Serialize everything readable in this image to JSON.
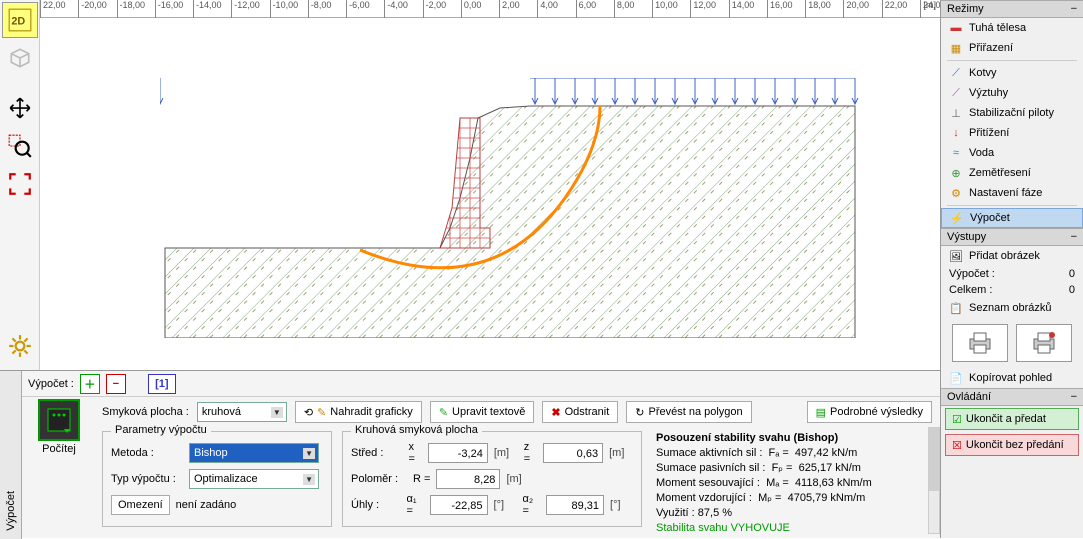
{
  "ruler": {
    "ticks": [
      "22,00",
      "-20,00",
      "-18,00",
      "-16,00",
      "-14,00",
      "-12,00",
      "-10,00",
      "-8,00",
      "-6,00",
      "-4,00",
      "-2,00",
      "0,00",
      "2,00",
      "4,00",
      "6,00",
      "8,00",
      "10,00",
      "12,00",
      "14,00",
      "16,00",
      "18,00",
      "20,00",
      "22,00",
      "24,00"
    ],
    "unit": "[m]"
  },
  "right": {
    "modes_title": "Režimy",
    "modes": [
      {
        "label": "Tuhá tělesa"
      },
      {
        "label": "Přiřazení"
      },
      {
        "label": "Kotvy"
      },
      {
        "label": "Výztuhy"
      },
      {
        "label": "Stabilizační piloty"
      },
      {
        "label": "Přitížení"
      },
      {
        "label": "Voda"
      },
      {
        "label": "Zemětřesení"
      },
      {
        "label": "Nastavení fáze"
      },
      {
        "label": "Výpočet"
      }
    ],
    "outputs_title": "Výstupy",
    "add_image": "Přidat obrázek",
    "calc_label": "Výpočet :",
    "calc_count": "0",
    "total_label": "Celkem :",
    "total_count": "0",
    "list_images": "Seznam obrázků",
    "copy_view": "Kopírovat pohled",
    "control_title": "Ovládání",
    "ok_btn": "Ukončit a předat",
    "cancel_btn": "Ukončit bez předání"
  },
  "bottom": {
    "side_label": "Výpočet",
    "bar_label": "Výpočet :",
    "tab1": "[1]",
    "calc_btn": "Počítej",
    "slip_label": "Smyková plocha :",
    "slip_value": "kruhová",
    "replace_btn": "Nahradit graficky",
    "edit_btn": "Upravit textově",
    "remove_btn": "Odstranit",
    "convert_btn": "Převést na polygon",
    "detail_btn": "Podrobné výsledky",
    "fs1_title": "Parametry výpočtu",
    "method_label": "Metoda :",
    "method_value": "Bishop",
    "type_label": "Typ výpočtu :",
    "type_value": "Optimalizace",
    "limit_btn": "Omezení",
    "limit_txt": "není zadáno",
    "fs2_title": "Kruhová smyková plocha",
    "center_label": "Střed :",
    "x_lbl": "x =",
    "x_val": "-3,24",
    "x_unit": "[m]",
    "z_lbl": "z =",
    "z_val": "0,63",
    "z_unit": "[m]",
    "r_label": "Poloměr :",
    "r_lbl": "R =",
    "r_val": "8,28",
    "r_unit": "[m]",
    "ang_label": "Úhly :",
    "a1_lbl": "α₁ =",
    "a1_val": "-22,85",
    "a1_unit": "[°]",
    "a2_lbl": "α₂ =",
    "a2_val": "89,31",
    "a2_unit": "[°]",
    "results": {
      "title": "Posouzení stability svahu (Bishop)",
      "l1a": "Sumace aktivních sil :",
      "l1b": "Fₐ =",
      "l1c": "497,42 kN/m",
      "l2a": "Sumace pasivních sil :",
      "l2b": "Fₚ =",
      "l2c": "625,17 kN/m",
      "l3a": "Moment sesouvající :",
      "l3b": "Mₐ =",
      "l3c": "4118,63 kNm/m",
      "l4a": "Moment vzdorující :",
      "l4b": "Mₚ =",
      "l4c": "4705,79 kNm/m",
      "l5": "Využití : 87,5 %",
      "l6": "Stabilita svahu VYHOVUJE"
    }
  }
}
